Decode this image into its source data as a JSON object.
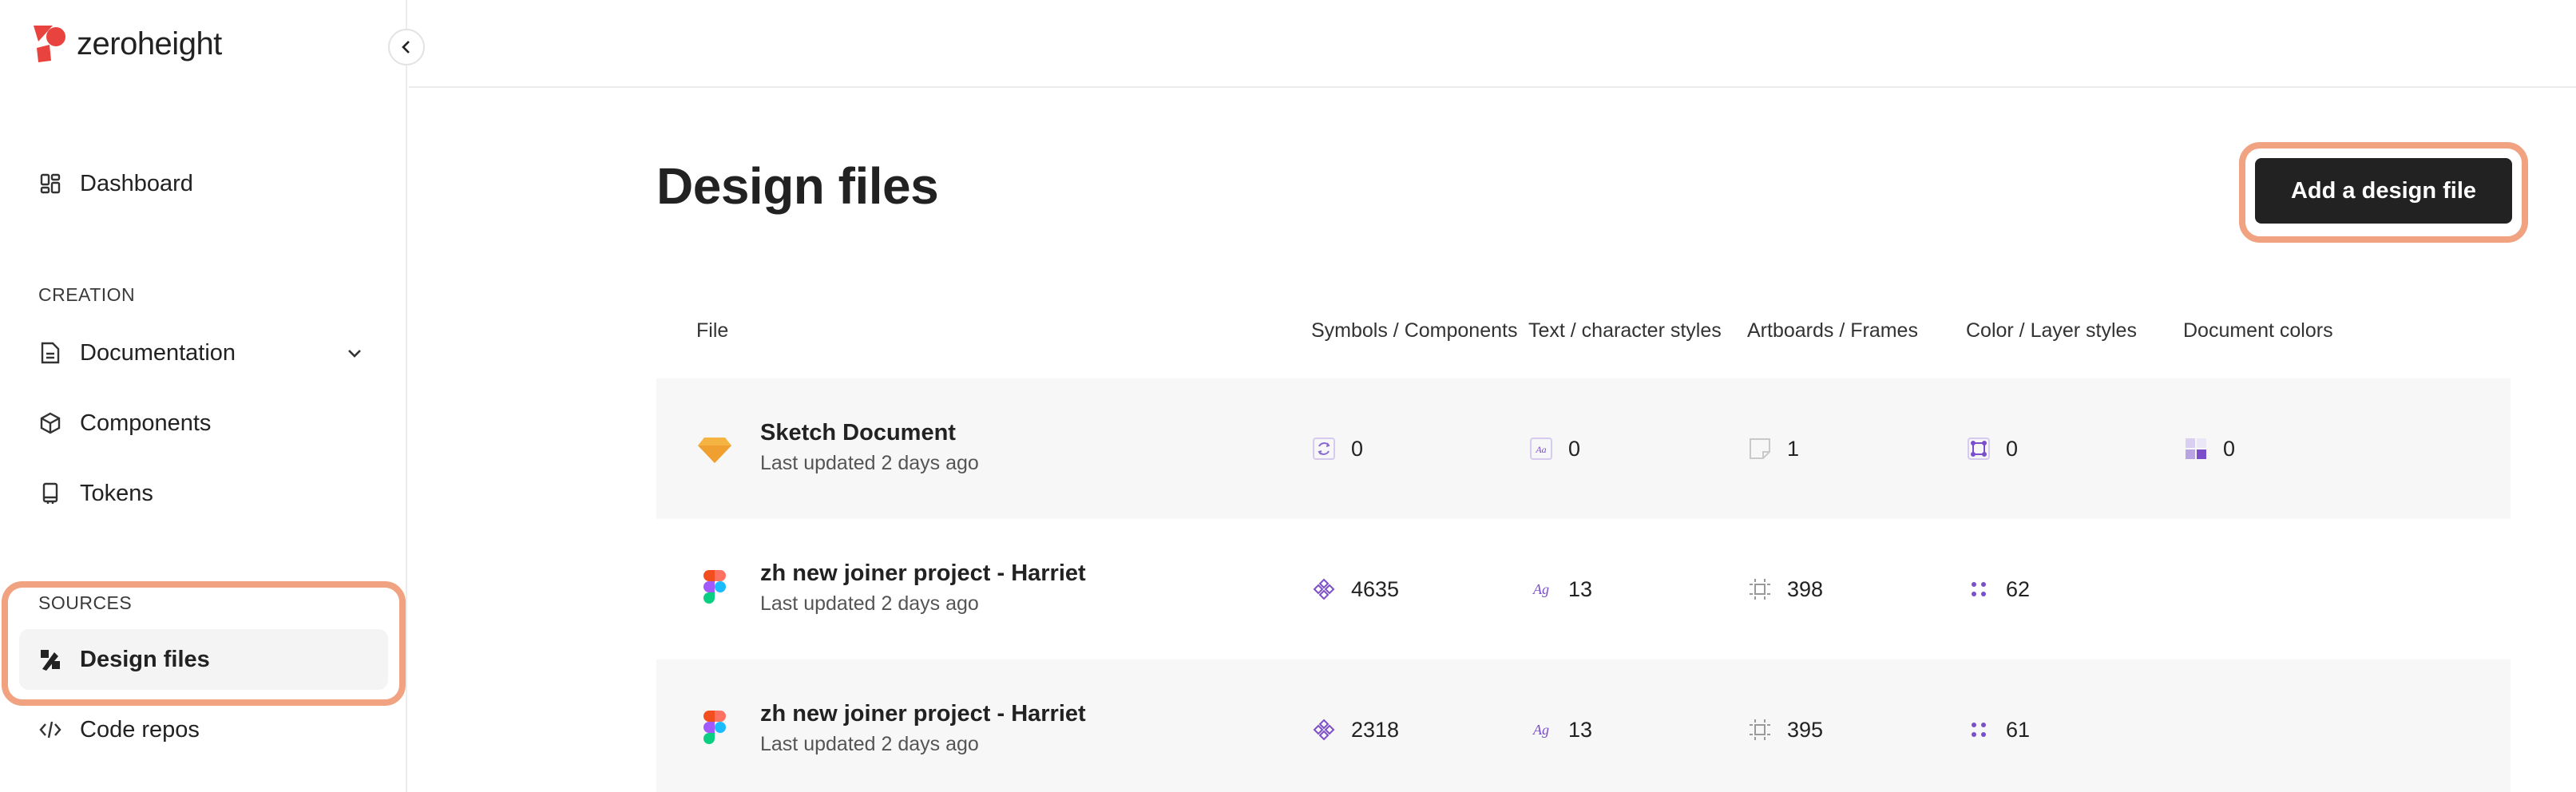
{
  "app": {
    "logo_text": "zeroheight"
  },
  "sidebar": {
    "dashboard": "Dashboard",
    "creation_label": "CREATION",
    "documentation": "Documentation",
    "components": "Components",
    "tokens": "Tokens",
    "sources_label": "SOURCES",
    "design_files": "Design files",
    "code_repos": "Code repos"
  },
  "main": {
    "title": "Design files",
    "add_button": "Add a design file",
    "columns": [
      "File",
      "Symbols / Components",
      "Text / character styles",
      "Artboards / Frames",
      "Color / Layer styles",
      "Document colors"
    ],
    "rows": [
      {
        "name": "Sketch Document",
        "updated": "Last updated 2 days ago",
        "icon": "sketch-icon",
        "symbols": "0",
        "text_styles": "0",
        "artboards": "1",
        "color_styles": "0",
        "doc_colors": "0"
      },
      {
        "name": "zh new joiner project - Harriet",
        "updated": "Last updated 2 days ago",
        "icon": "figma-icon",
        "symbols": "4635",
        "text_styles": "13",
        "artboards": "398",
        "color_styles": "62",
        "doc_colors": ""
      },
      {
        "name": "zh new joiner project - Harriet",
        "updated": "Last updated 2 days ago",
        "icon": "figma-icon",
        "symbols": "2318",
        "text_styles": "13",
        "artboards": "395",
        "color_styles": "61",
        "doc_colors": ""
      }
    ]
  },
  "colors": {
    "accent_highlight": "#f1a280",
    "brand_red": "#e8433f",
    "button_bg": "#222222",
    "purple": "#7b4fc9"
  }
}
